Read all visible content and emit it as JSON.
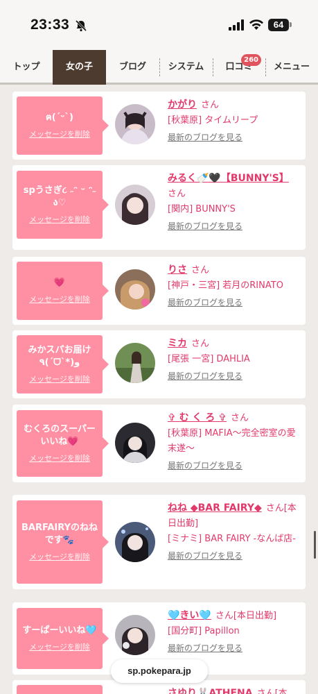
{
  "status": {
    "time": "23:33",
    "battery": "64"
  },
  "nav": {
    "tabs": [
      {
        "label": "トップ"
      },
      {
        "label": "女の子",
        "active": true
      },
      {
        "label": "ブログ"
      },
      {
        "label": "システム"
      },
      {
        "label": "口コミ",
        "badge": "260"
      },
      {
        "label": "メニュー"
      }
    ]
  },
  "delete_label": "メッセージを削除",
  "blog_label": "最新のブログを見る",
  "girls": [
    {
      "message": "ฅ(ˊᵕˋ)",
      "name": "かがり",
      "suffix": "さん",
      "shop": "[秋葉原] タイムリープ"
    },
    {
      "message": "spうさぎ૮ ˶ᵔ ᵕ ᵔ˶ ა♡",
      "name": "みるく🍼🖤【BUNNY'S】",
      "suffix": "さん",
      "shop": "[関内] BUNNY'S"
    },
    {
      "message": "💗",
      "name": "りさ",
      "suffix": "さん",
      "shop": "[神戸・三宮] 若月のRINATO"
    },
    {
      "message": "みかスパお届け ٩(ˊᗜˋ*)و",
      "name": "ミカ",
      "suffix": "さん",
      "shop": "[尾張 一宮] DAHLIA"
    },
    {
      "message": "むくろのスーパーいいね💗",
      "name": "✞ む く ろ ✞",
      "suffix": "さん",
      "shop": "[秋葉原] MAFIA～完全密室の愛末遂～"
    },
    {
      "message": "BARFAIRYのねねです🐾",
      "name": "ねね ◆BAR FAIRY◆",
      "suffix": "さん[本日出勤]",
      "shop": "[ミナミ] BAR FAIRY -なんば店-"
    },
    {
      "message": "すーぱーいいね🩵",
      "name": "🩵きい🩵",
      "suffix": "さん[本日出勤]",
      "shop": "[国分町] Papillon"
    },
    {
      "message": "",
      "name": "さゆり🐰ATHENA",
      "suffix": "さん[本",
      "shop": ""
    }
  ],
  "url": "sp.pokepara.jp"
}
